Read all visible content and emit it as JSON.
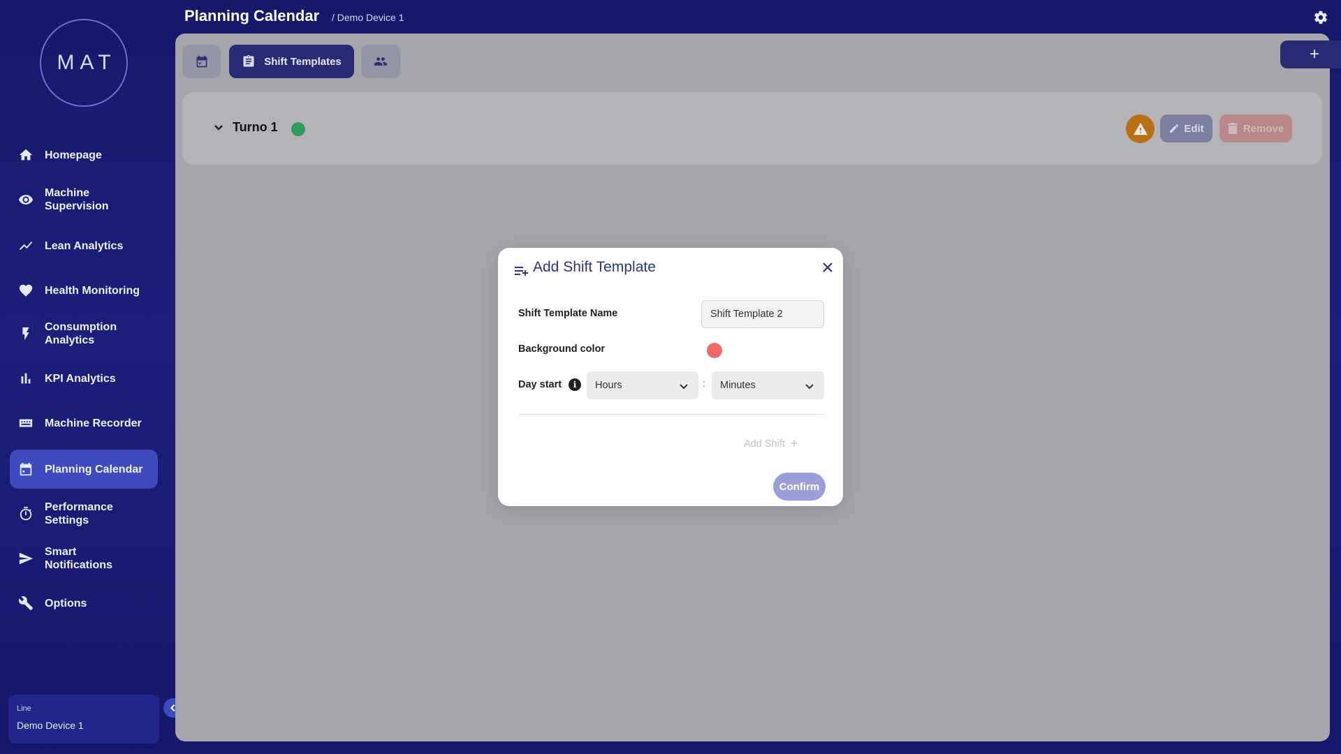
{
  "logo": {
    "text": "MAT"
  },
  "header": {
    "title": "Planning Calendar",
    "breadcrumb": "/ Demo Device 1"
  },
  "sidebar": {
    "items": [
      {
        "label": "Homepage",
        "icon": "home-icon"
      },
      {
        "label": "Machine Supervision",
        "icon": "eye-icon"
      },
      {
        "label": "Lean Analytics",
        "icon": "trend-icon"
      },
      {
        "label": "Health Monitoring",
        "icon": "heart-icon"
      },
      {
        "label": "Consumption Analytics",
        "icon": "bolt-icon"
      },
      {
        "label": "KPI Analytics",
        "icon": "bar-chart-icon"
      },
      {
        "label": "Machine Recorder",
        "icon": "recorder-icon"
      },
      {
        "label": "Planning Calendar",
        "icon": "calendar-icon",
        "active": true
      },
      {
        "label": "Performance Settings",
        "icon": "stopwatch-icon"
      },
      {
        "label": "Smart Notifications",
        "icon": "send-icon"
      },
      {
        "label": "Options",
        "icon": "wrench-icon"
      }
    ],
    "line": {
      "caption": "Line",
      "value": "Demo Device 1"
    }
  },
  "toolbar": {
    "tabs": [
      {
        "label": "",
        "icon": "calendar-icon"
      },
      {
        "label": "Shift Templates",
        "icon": "clipboard-icon",
        "active": true
      },
      {
        "label": "",
        "icon": "users-icon"
      }
    ],
    "add_label": "+"
  },
  "template_card": {
    "name": "Turno 1",
    "dot_color": "#2f9c5e",
    "edit_label": "Edit",
    "remove_label": "Remove"
  },
  "modal": {
    "title": "Add Shift Template",
    "fields": {
      "name_label": "Shift Template Name",
      "name_value": "Shift Template 2",
      "color_label": "Background color",
      "color_value": "#f06a6a",
      "day_start_label": "Day start",
      "hours_placeholder": "Hours",
      "minutes_placeholder": "Minutes",
      "separator": ":"
    },
    "add_shift_label": "Add Shift",
    "confirm_label": "Confirm"
  },
  "colors": {
    "sidebar_bg": "#16196a",
    "accent": "#3d4bbf",
    "dark_button": "#272b74",
    "warning": "#b96f14"
  }
}
